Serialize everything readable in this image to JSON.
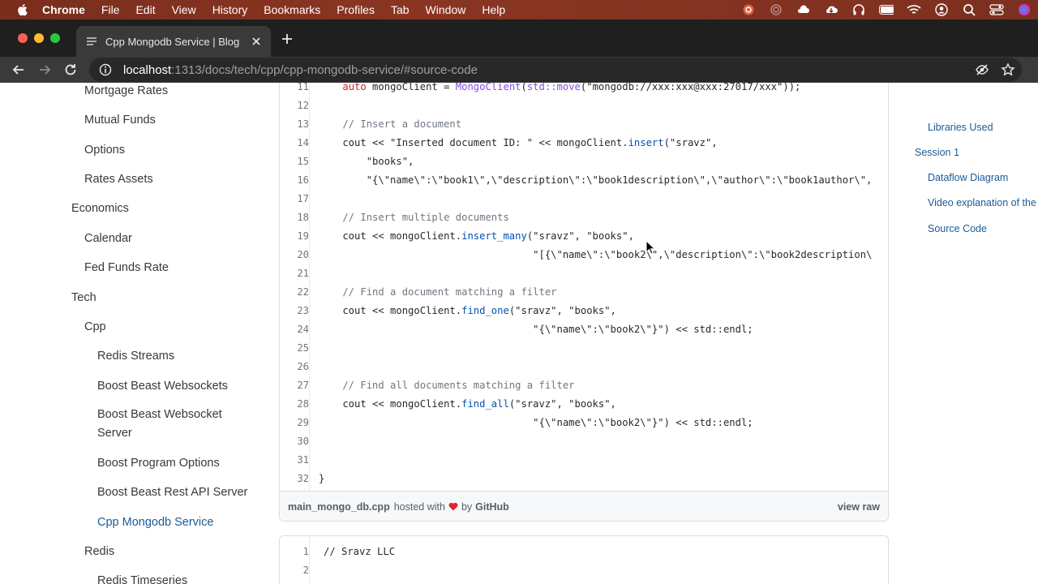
{
  "menubar": {
    "app": "Chrome",
    "items": [
      "File",
      "Edit",
      "View",
      "History",
      "Bookmarks",
      "Profiles",
      "Tab",
      "Window",
      "Help"
    ]
  },
  "tab": {
    "title": "Cpp Mongodb Service | Blog"
  },
  "address": {
    "host": "localhost",
    "path": ":1313/docs/tech/cpp/cpp-mongodb-service/#source-code"
  },
  "sidebar": {
    "items": [
      "Mortgage Rates",
      "Mutual Funds",
      "Options",
      "Rates Assets",
      "Economics",
      "Calendar",
      "Fed Funds Rate",
      "Tech",
      "Cpp",
      "Redis Streams",
      "Boost Beast Websockets",
      "Boost Beast Websocket",
      "Server",
      "Boost Program Options",
      "Boost Beast Rest API Server",
      "Cpp Mongodb Service",
      "Redis",
      "Redis Timeseries"
    ]
  },
  "code": {
    "lines": [
      {
        "n": "11",
        "text": "    auto mongoClient = MongoClient(std::move(\"mongodb://xxx:xxx@xxx:27017/xxx\"));"
      },
      {
        "n": "12",
        "text": ""
      },
      {
        "n": "13",
        "text": "    // Insert a document"
      },
      {
        "n": "14",
        "text": "    cout << \"Inserted document ID: \" << mongoClient.insert(\"sravz\","
      },
      {
        "n": "15",
        "text": "        \"books\","
      },
      {
        "n": "16",
        "text": "        \"{\\\"name\\\":\\\"book1\\\",\\\"description\\\":\\\"book1description\\\",\\\"author\\\":\\\"book1author\\\","
      },
      {
        "n": "17",
        "text": ""
      },
      {
        "n": "18",
        "text": "    // Insert multiple documents"
      },
      {
        "n": "19",
        "text": "    cout << mongoClient.insert_many(\"sravz\", \"books\","
      },
      {
        "n": "20",
        "text": "                                    \"[{\\\"name\\\":\\\"book2\\\",\\\"description\\\":\\\"book2description\\"
      },
      {
        "n": "21",
        "text": ""
      },
      {
        "n": "22",
        "text": "    // Find a document matching a filter"
      },
      {
        "n": "23",
        "text": "    cout << mongoClient.find_one(\"sravz\", \"books\","
      },
      {
        "n": "24",
        "text": "                                    \"{\\\"name\\\":\\\"book2\\\"}\") << std::endl;"
      },
      {
        "n": "25",
        "text": ""
      },
      {
        "n": "26",
        "text": ""
      },
      {
        "n": "27",
        "text": "    // Find all documents matching a filter"
      },
      {
        "n": "28",
        "text": "    cout << mongoClient.find_all(\"sravz\", \"books\","
      },
      {
        "n": "29",
        "text": "                                    \"{\\\"name\\\":\\\"book2\\\"}\") << std::endl;"
      },
      {
        "n": "30",
        "text": ""
      },
      {
        "n": "31",
        "text": ""
      },
      {
        "n": "32",
        "text": "}"
      }
    ]
  },
  "gist": {
    "filename": "main_mongo_db.cpp",
    "hosted": "hosted with",
    "by": "by",
    "github": "GitHub",
    "view_raw": "view raw"
  },
  "gist2": {
    "lines": [
      {
        "n": "1",
        "text": "// Sravz LLC"
      },
      {
        "n": "2",
        "text": ""
      }
    ]
  },
  "toc": {
    "items": [
      "Libraries Used",
      "Session 1",
      "Dataflow Diagram",
      "Video explanation of the",
      "Source Code"
    ]
  },
  "colors": {
    "link": "#1b5b96",
    "comment": "#6e7781",
    "method": "#0550ae"
  }
}
